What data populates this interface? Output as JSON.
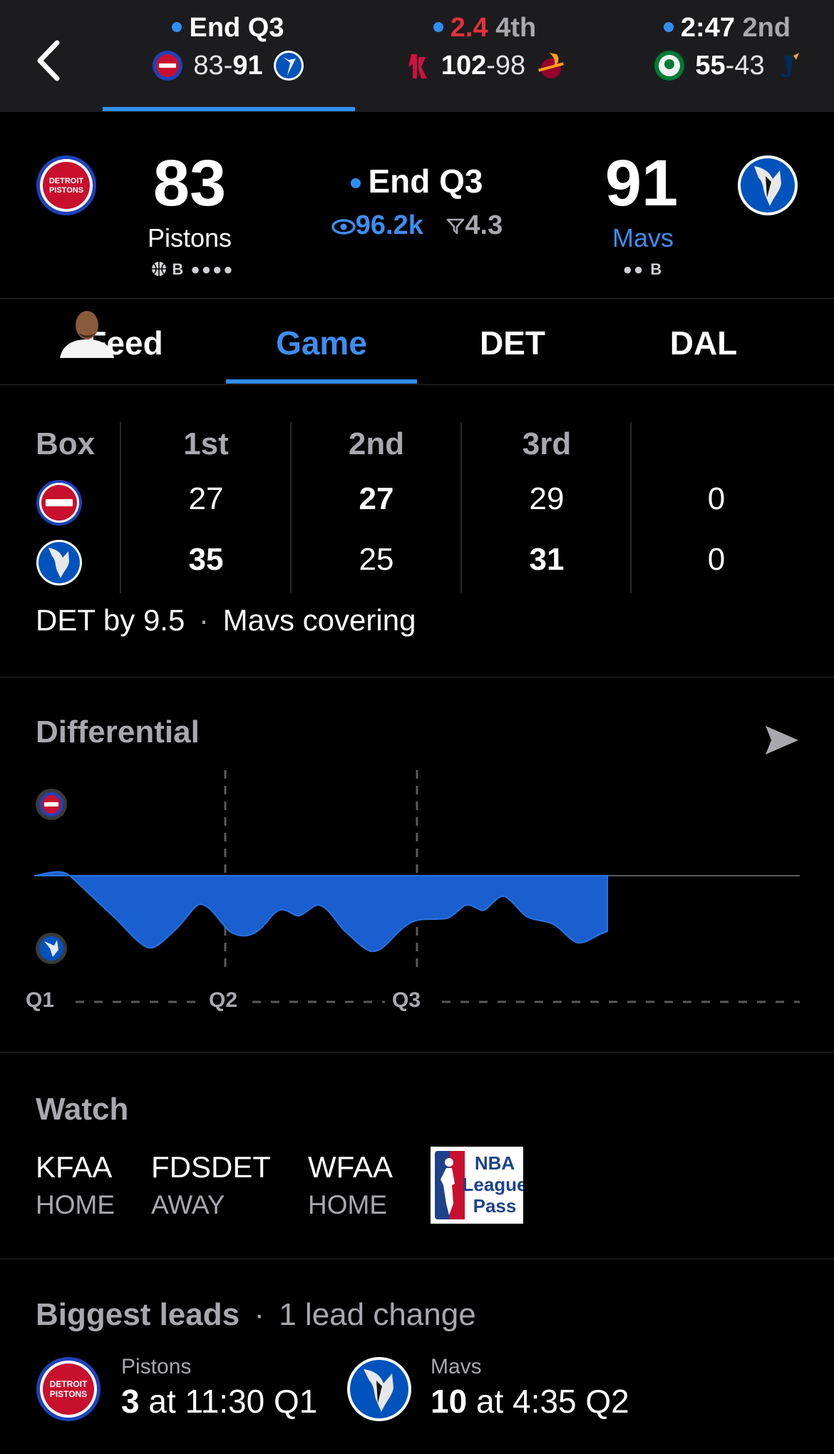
{
  "scoreboard": [
    {
      "status_main": "End Q3",
      "status_dim": "",
      "status_red": "",
      "away_score": "83",
      "home_score": "91",
      "away": "DET",
      "home": "DAL"
    },
    {
      "status_red": "2.4",
      "status_dim": "4th",
      "away_score": "102",
      "home_score": "98",
      "away": "HOU",
      "home": "MIA"
    },
    {
      "status_main": "2:47",
      "status_dim": "2nd",
      "away_score": "55",
      "home_score": "43",
      "away": "BOS",
      "home": "UTA"
    }
  ],
  "header": {
    "away": {
      "score": "83",
      "name": "Pistons",
      "sub": "B ●●●●",
      "logo_text": "DETROIT PISTONS"
    },
    "home": {
      "score": "91",
      "name": "Mavs",
      "sub": "●● B"
    },
    "status": "End Q3",
    "viewers": "96.2k",
    "odds": "4.3"
  },
  "tabs": [
    "Feed",
    "Game",
    "DET",
    "DAL"
  ],
  "active_tab": "Game",
  "box_score": {
    "label": "Box",
    "periods": [
      "1st",
      "2nd",
      "3rd",
      ""
    ],
    "rows": [
      {
        "team": "DET",
        "values": [
          "27",
          "27",
          "29",
          "0"
        ]
      },
      {
        "team": "DAL",
        "values": [
          "35",
          "25",
          "31",
          "0"
        ]
      }
    ],
    "spread_text": "DET by 9.5",
    "spread_sep": "·",
    "cover_text": "Mavs covering"
  },
  "differential": {
    "title": "Differential",
    "quarter_labels": [
      "Q1",
      "Q2",
      "Q3"
    ],
    "fill_color": "#1a5fcf"
  },
  "watch": {
    "title": "Watch",
    "channels": [
      {
        "name": "KFAA",
        "side": "HOME"
      },
      {
        "name": "FDSDET",
        "side": "AWAY"
      },
      {
        "name": "WFAA",
        "side": "HOME"
      }
    ],
    "league_pass": {
      "line1": "NBA",
      "line2": "League",
      "line3": "Pass"
    }
  },
  "biggest_leads": {
    "title": "Biggest leads",
    "sep": "·",
    "subtitle": "1 lead change",
    "teams": [
      {
        "name": "Pistons",
        "lead": "3",
        "at": "at 11:30 Q1"
      },
      {
        "name": "Mavs",
        "lead": "10",
        "at": "at 4:35 Q2"
      }
    ]
  },
  "colors": {
    "accent": "#2f8ef4",
    "pistons_blue": "#1d42ba",
    "pistons_red": "#c8102e",
    "mavs_blue": "#0053bc",
    "live_red": "#e5303a"
  }
}
